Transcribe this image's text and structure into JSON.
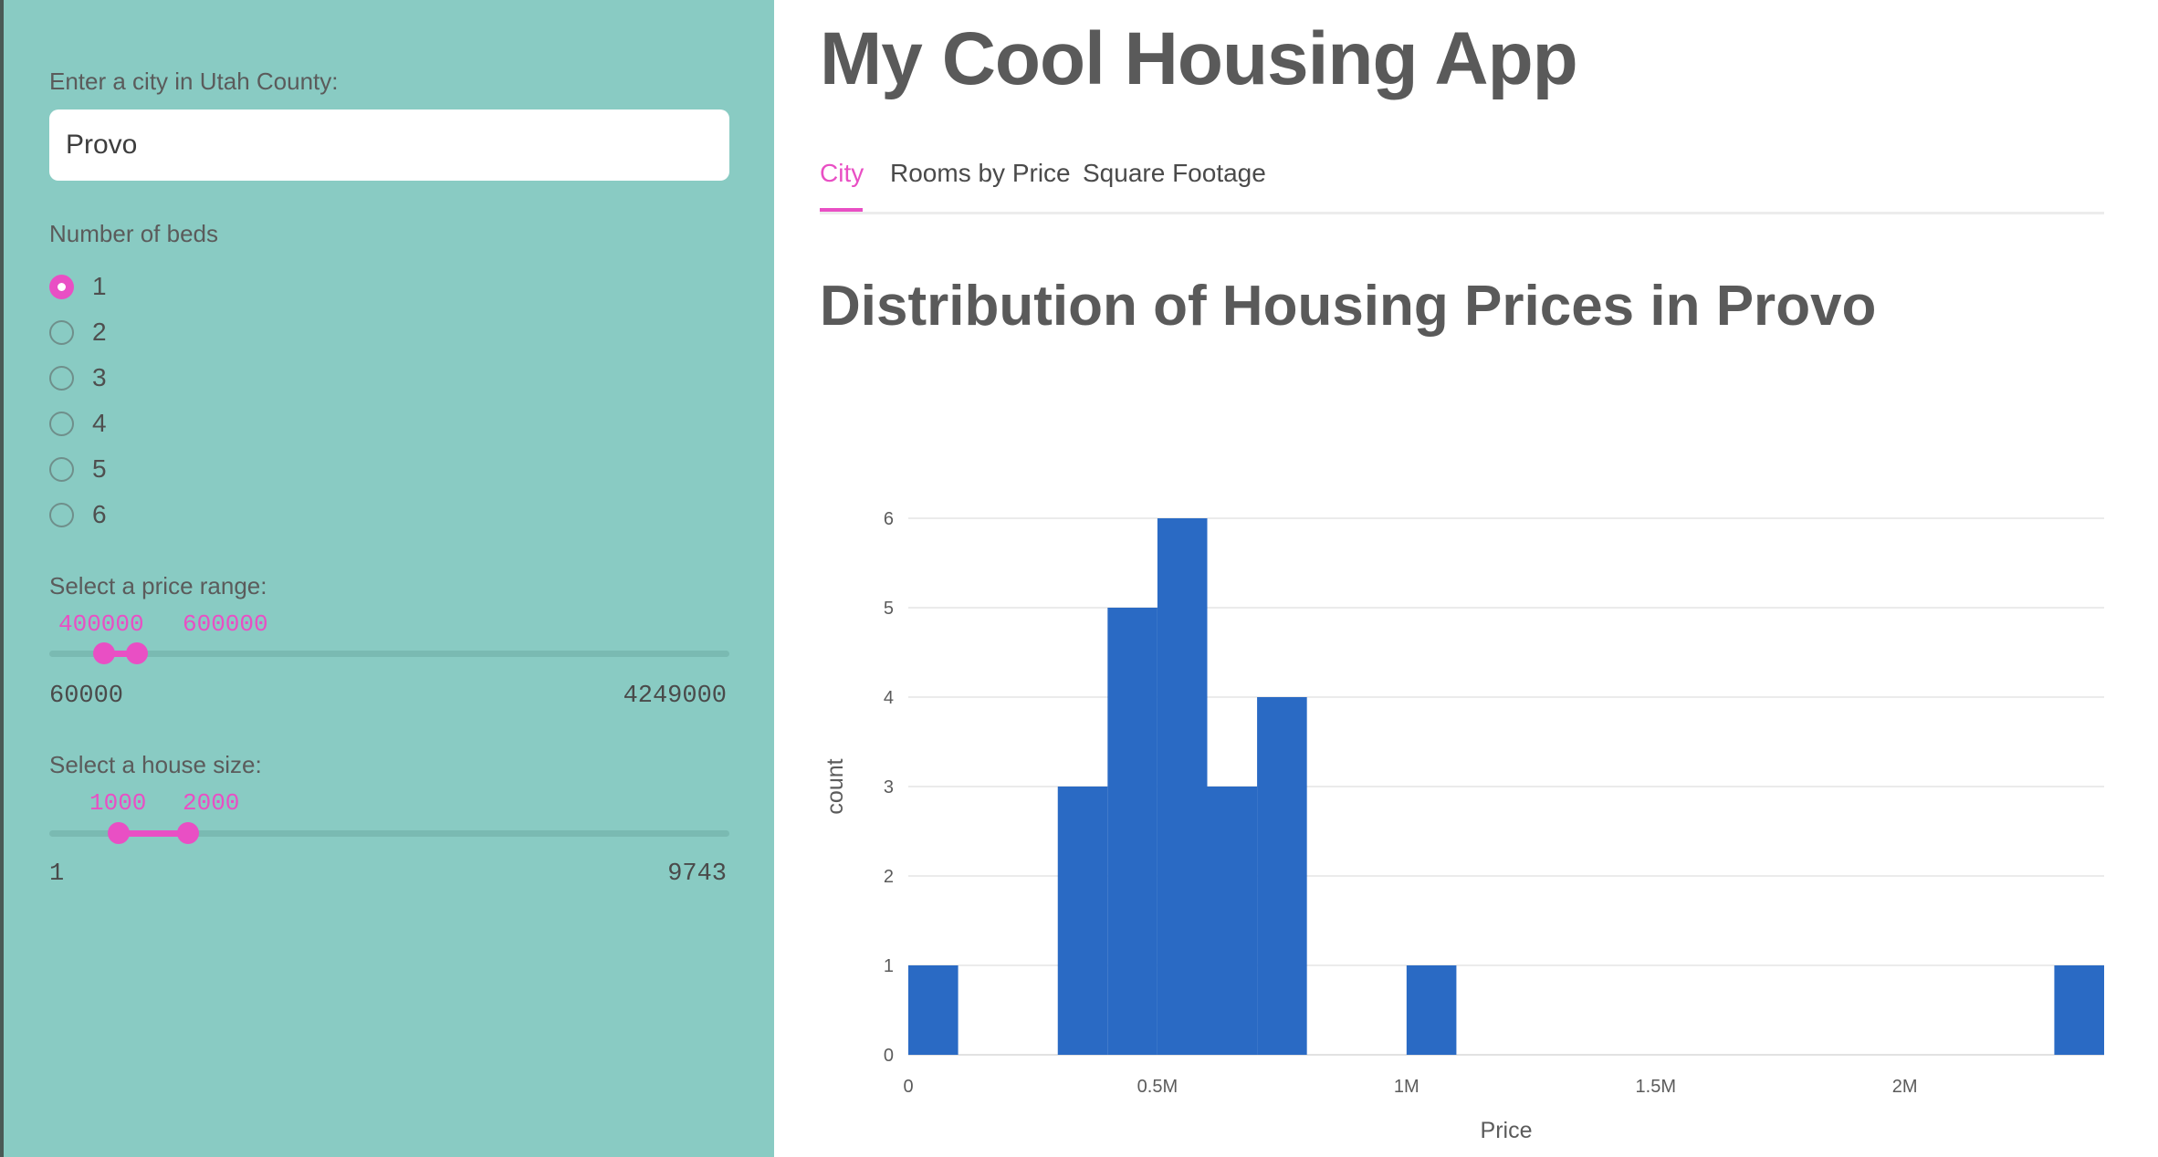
{
  "sidebar": {
    "city_label": "Enter a city in Utah County:",
    "city_value": "Provo",
    "beds_label": "Number of beds",
    "beds_options": [
      "1",
      "2",
      "3",
      "4",
      "5",
      "6"
    ],
    "beds_selected": "1",
    "price": {
      "label": "Select a price range:",
      "low": "400000",
      "high": "600000",
      "min": "60000",
      "max": "4249000"
    },
    "size": {
      "label": "Select a house size:",
      "low": "1000",
      "high": "2000",
      "min": "1",
      "max": "9743"
    }
  },
  "main": {
    "title": "My Cool Housing App",
    "tabs": [
      {
        "label": "City"
      },
      {
        "label": "Rooms by Price"
      },
      {
        "label": "Square Footage"
      }
    ],
    "active_tab": "City",
    "heading": "Distribution of Housing Prices in Provo"
  },
  "colors": {
    "accent": "#e94fc4",
    "sidebar_bg": "#89cbc3",
    "bar": "#2a6ac4"
  },
  "chart_data": {
    "type": "bar",
    "bins": [
      {
        "start": 0,
        "end": 100000,
        "count": 1
      },
      {
        "start": 300000,
        "end": 400000,
        "count": 3
      },
      {
        "start": 400000,
        "end": 500000,
        "count": 5
      },
      {
        "start": 500000,
        "end": 600000,
        "count": 6
      },
      {
        "start": 600000,
        "end": 700000,
        "count": 3
      },
      {
        "start": 700000,
        "end": 800000,
        "count": 4
      },
      {
        "start": 1000000,
        "end": 1100000,
        "count": 1
      },
      {
        "start": 2300000,
        "end": 2400000,
        "count": 1
      }
    ],
    "xlabel": "Price",
    "ylabel": "count",
    "xlim": [
      0,
      2400000
    ],
    "ylim": [
      0,
      6
    ],
    "x_ticks": [
      {
        "value": 0,
        "label": "0"
      },
      {
        "value": 500000,
        "label": "0.5M"
      },
      {
        "value": 1000000,
        "label": "1M"
      },
      {
        "value": 1500000,
        "label": "1.5M"
      },
      {
        "value": 2000000,
        "label": "2M"
      }
    ],
    "y_ticks": [
      0,
      1,
      2,
      3,
      4,
      5,
      6
    ],
    "grid": true
  }
}
